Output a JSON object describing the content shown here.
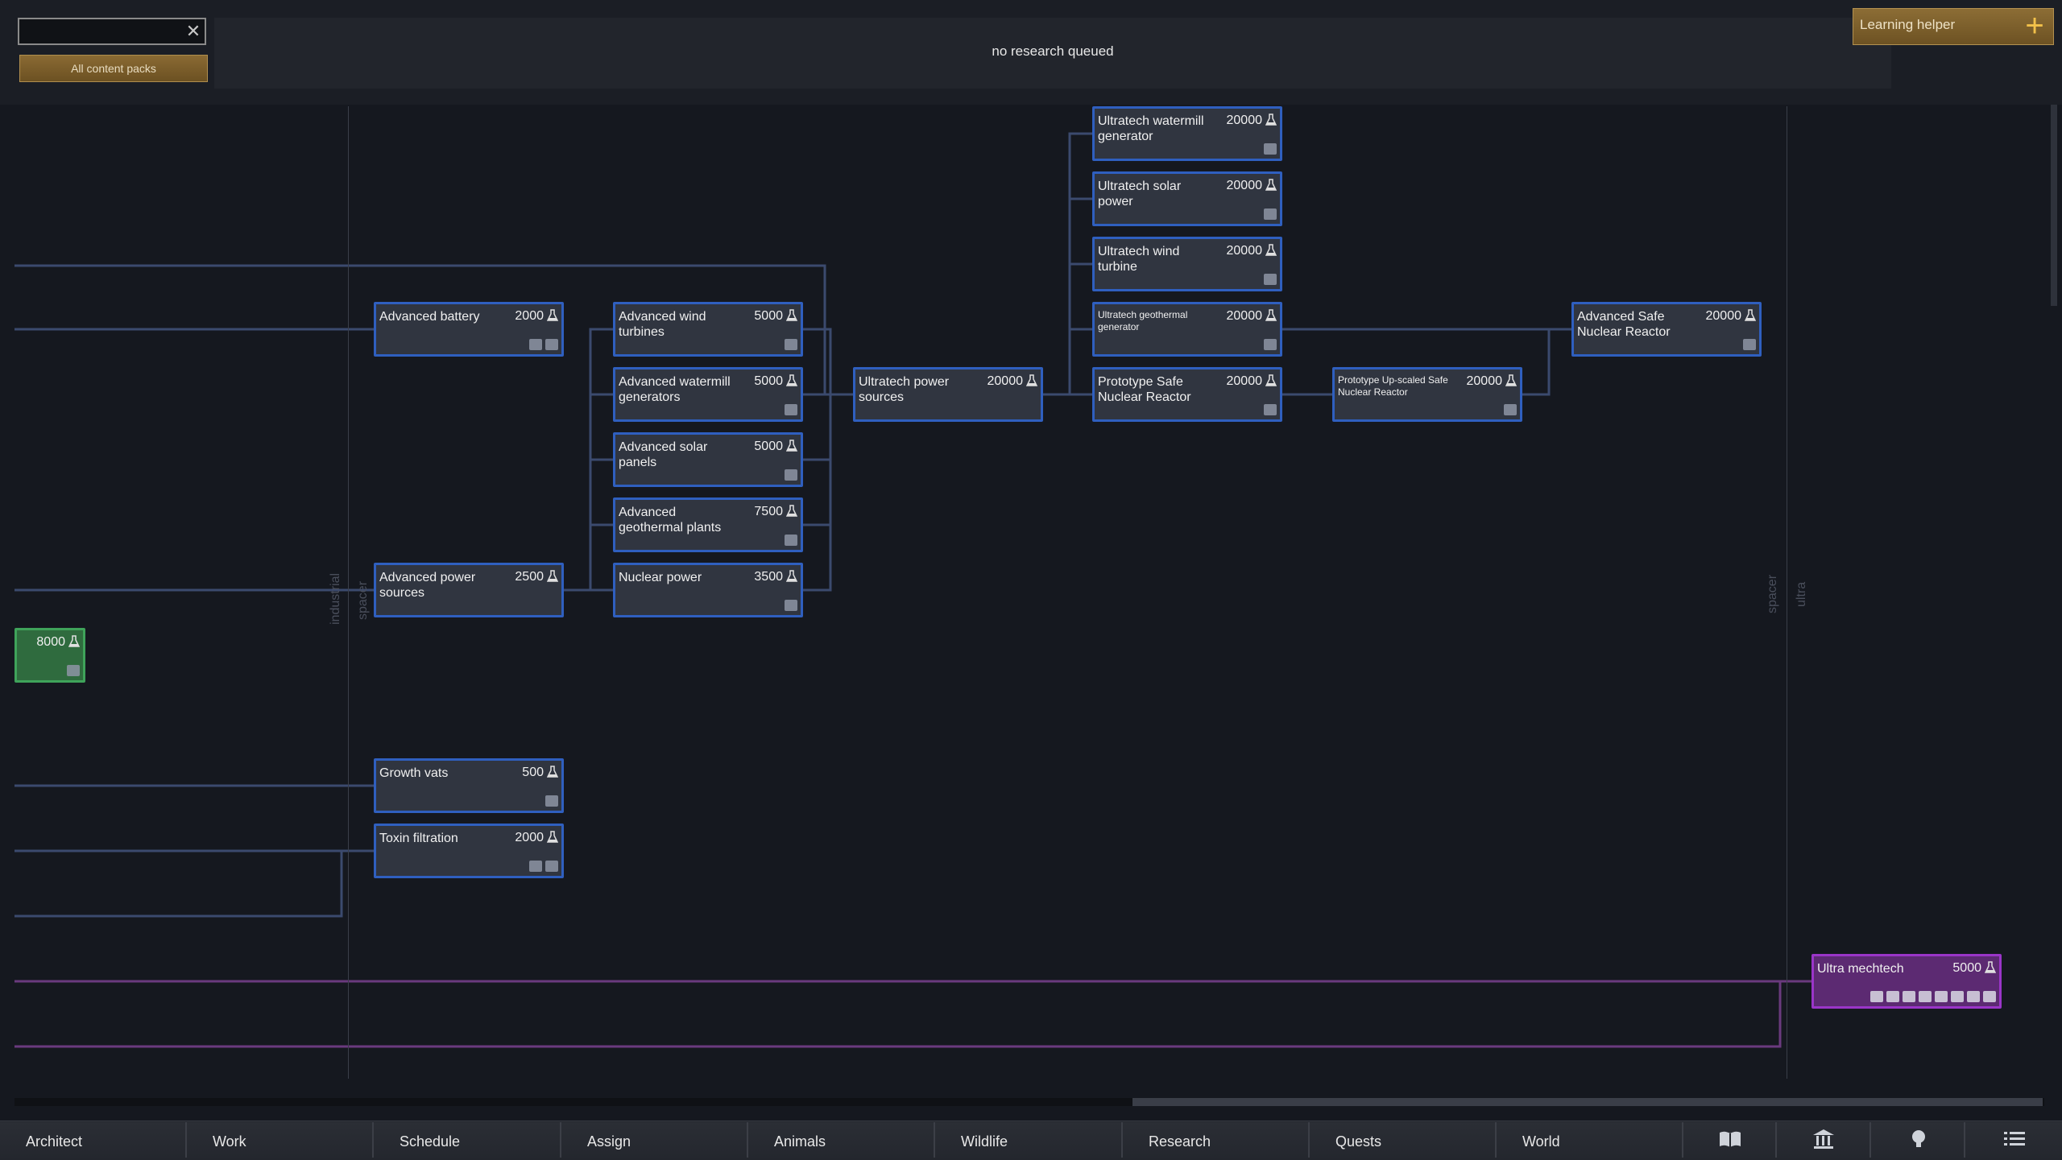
{
  "search": {
    "value": "",
    "placeholder": "",
    "clear_symbol": "✕"
  },
  "content_filter": {
    "label": "All content packs"
  },
  "queue": {
    "status_text": "no research queued"
  },
  "helper": {
    "label": "Learning helper",
    "icon": "plus-icon"
  },
  "eras": [
    "industrial",
    "spacer",
    "spacer",
    "ultra"
  ],
  "nodes": [
    {
      "id": "advanced-battery",
      "label": "Advanced battery",
      "cost": "2000",
      "icons": 2
    },
    {
      "id": "advanced-power-sources",
      "label": "Advanced power sources",
      "cost": "2500",
      "icons": 0
    },
    {
      "id": "green-node",
      "label": "",
      "cost": "8000",
      "icons": 1
    },
    {
      "id": "growth-vats",
      "label": "Growth vats",
      "cost": "500",
      "icons": 1
    },
    {
      "id": "toxin-filtration",
      "label": "Toxin filtration",
      "cost": "2000",
      "icons": 2
    },
    {
      "id": "advanced-wind-turbines",
      "label": "Advanced wind turbines",
      "cost": "5000",
      "icons": 1
    },
    {
      "id": "advanced-watermill-generators",
      "label": "Advanced watermill generators",
      "cost": "5000",
      "icons": 1
    },
    {
      "id": "advanced-solar-panels",
      "label": "Advanced solar panels",
      "cost": "5000",
      "icons": 1
    },
    {
      "id": "advanced-geothermal-plants",
      "label": "Advanced geothermal plants",
      "cost": "7500",
      "icons": 1
    },
    {
      "id": "nuclear-power",
      "label": "Nuclear power",
      "cost": "3500",
      "icons": 1
    },
    {
      "id": "ultratech-power-sources",
      "label": "Ultratech power sources",
      "cost": "20000",
      "icons": 0
    },
    {
      "id": "ultratech-watermill-generator",
      "label": "Ultratech watermill generator",
      "cost": "20000",
      "icons": 1
    },
    {
      "id": "ultratech-solar-power",
      "label": "Ultratech solar power",
      "cost": "20000",
      "icons": 1
    },
    {
      "id": "ultratech-wind-turbine",
      "label": "Ultratech wind turbine",
      "cost": "20000",
      "icons": 1
    },
    {
      "id": "ultratech-geothermal-generator",
      "label": "Ultratech geothermal generator",
      "cost": "20000",
      "icons": 1,
      "small": true
    },
    {
      "id": "prototype-safe-nuclear-reactor",
      "label": "Prototype Safe Nuclear Reactor",
      "cost": "20000",
      "icons": 1
    },
    {
      "id": "prototype-upscaled-safe-nuclear-reactor",
      "label": "Prototype Up-scaled Safe Nuclear Reactor",
      "cost": "20000",
      "icons": 1,
      "small": true
    },
    {
      "id": "advanced-safe-nuclear-reactor",
      "label": "Advanced Safe Nuclear Reactor",
      "cost": "20000",
      "icons": 1
    },
    {
      "id": "ultra-mechtech",
      "label": "Ultra mechtech",
      "cost": "5000",
      "icons": 8
    }
  ],
  "tabs": [
    "Architect",
    "Work",
    "Schedule",
    "Assign",
    "Animals",
    "Wildlife",
    "Research",
    "Quests",
    "World"
  ],
  "icon_tabs": [
    "book-icon",
    "factions-icon",
    "lightbulb-icon",
    "menu-list-icon"
  ],
  "colors": {
    "node_border": "#2f5fbf",
    "node_fill": "#303540",
    "green_fill": "#2f6b3e",
    "purple_fill": "#5c2a72",
    "accent": "#f2c14a"
  }
}
